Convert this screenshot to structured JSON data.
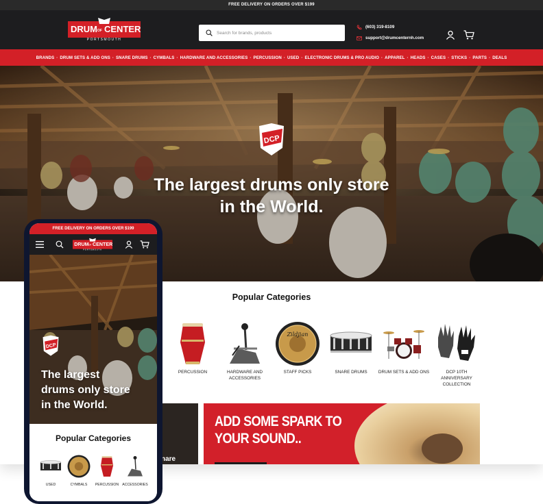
{
  "desktop": {
    "topbar": "FREE DELIVERY ON ORDERS OVER $199",
    "logo": {
      "line1": "DRUM",
      "of": "OF",
      "line2": "CENTER",
      "sub": "PORTSMOUTH"
    },
    "search_placeholder": "Search for brands, products",
    "phone": "(603) 319-8109",
    "email": "support@drumcenternh.com",
    "nav": [
      "BRANDS",
      "DRUM SETS & ADD ONS",
      "SNARE DRUMS",
      "CYMBALS",
      "HARDWARE AND ACCESSORIES",
      "PERCUSSION",
      "USED",
      "ELECTRONIC DRUMS & PRO AUDIO",
      "APPAREL",
      "HEADS",
      "CASES",
      "STICKS",
      "PARTS",
      "DEALS"
    ],
    "hero_badge": "DCP",
    "hero_line1": "The largest drums only store",
    "hero_line2": "in the World.",
    "popular_title": "Popular Categories",
    "categories": [
      {
        "label": "PERCUSSION",
        "icon": "conga-icon"
      },
      {
        "label": "HARDWARE AND ACCESSORIES",
        "icon": "pedal-icon"
      },
      {
        "label": "STAFF PICKS",
        "icon": "gong-icon"
      },
      {
        "label": "SNARE DRUMS",
        "icon": "snare-icon"
      },
      {
        "label": "DRUM SETS & ADD ONS",
        "icon": "drumset-icon"
      },
      {
        "label": "DCP 10TH ANNIVERSARY COLLECTION",
        "icon": "gloves-icon"
      }
    ],
    "promo_dark_text": "nare",
    "promo_red_line1": "ADD SOME SPARK TO",
    "promo_red_line2": "YOUR SOUND.."
  },
  "mobile": {
    "topbar": "FREE DELIVERY ON ORDERS OVER $199",
    "hero_line1": "The largest",
    "hero_line2": "drums only store",
    "hero_line3": "in the World.",
    "popular_title": "Popular Categories",
    "categories": [
      {
        "label": "USED",
        "icon": "snare-icon"
      },
      {
        "label": "CYMBALS",
        "icon": "gong-icon"
      },
      {
        "label": "PERCUSSION",
        "icon": "conga-icon"
      },
      {
        "label": "ACCESSORIES",
        "icon": "pedal-icon"
      }
    ]
  },
  "colors": {
    "brand_red": "#d32027",
    "header_dark": "#1d1d1f",
    "phone_frame": "#0e1630"
  }
}
